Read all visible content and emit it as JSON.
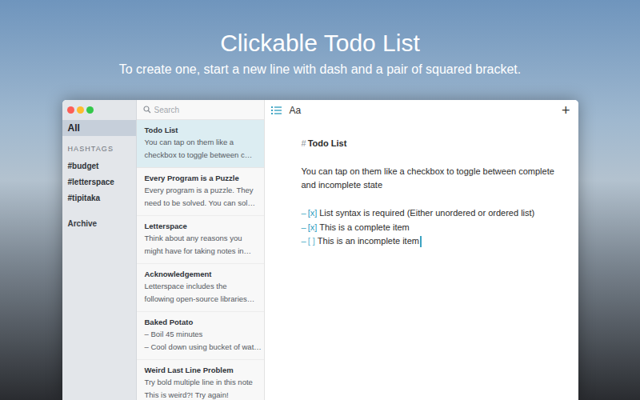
{
  "hero": {
    "title": "Clickable Todo List",
    "subtitle": "To create one, start a new line with dash and a pair of squared bracket."
  },
  "sidebar": {
    "items": [
      {
        "label": "All",
        "selected": true
      }
    ],
    "section": "HASHTAGS",
    "hashtags": [
      "#budget",
      "#letterspace",
      "#tipitaka"
    ],
    "archive": "Archive"
  },
  "search": {
    "placeholder": "Search"
  },
  "notes": [
    {
      "title": "Todo List",
      "preview": [
        "You can tap on them like a",
        "checkbox to toggle between c…"
      ],
      "selected": true
    },
    {
      "title": "Every Program is a Puzzle",
      "preview": [
        "Every program is a puzzle. They",
        "need to be solved. You can sol…"
      ],
      "selected": false
    },
    {
      "title": "Letterspace",
      "preview": [
        "Think about any reasons you",
        "might have for taking notes in…"
      ],
      "selected": false
    },
    {
      "title": "Acknowledgement",
      "preview": [
        "Letterspace includes the",
        "following open-source libraries…"
      ],
      "selected": false
    },
    {
      "title": "Baked Potato",
      "preview": [
        "– Boil 45 minutes",
        "– Cool down using bucket of wat…"
      ],
      "selected": false
    },
    {
      "title": "Weird Last Line Problem",
      "preview": [
        "Try bold multiple line in this note",
        "This is weird?! Try again!"
      ],
      "selected": false
    }
  ],
  "toolbar": {
    "format": "Aa",
    "add": "+"
  },
  "editor": {
    "heading_mark": "#",
    "heading": "Todo List",
    "paragraph": [
      "You can tap on them like a checkbox to toggle between complete",
      "and incomplete state"
    ],
    "todos": [
      {
        "dash": "–",
        "box": "[x]",
        "text": "List syntax is required (Either unordered or ordered list)",
        "checked": true
      },
      {
        "dash": "–",
        "box": "[x]",
        "text": "This is a complete item",
        "checked": true
      },
      {
        "dash": "–",
        "box": "[ ]",
        "text": "This is an incomplete item",
        "checked": false
      }
    ],
    "focused": true
  }
}
